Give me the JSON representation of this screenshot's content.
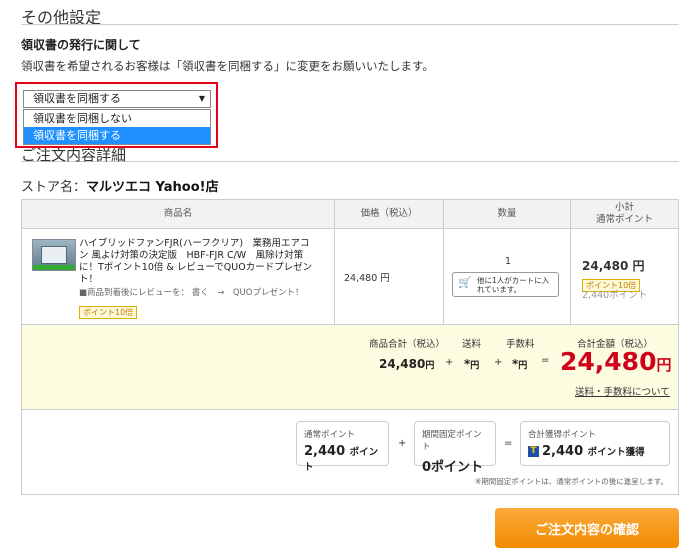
{
  "other_settings": {
    "title": "その他設定",
    "receipt_heading": "領収書の発行に関して",
    "receipt_desc": "領収書を希望されるお客様は「領収書を同梱する」に変更をお願いいたします。",
    "select_value": "領収書を同梱する",
    "options": [
      "領収書を同梱しない",
      "領収書を同梱する"
    ],
    "highlight_color": "#1e90ff",
    "frame_color": "#e4001b"
  },
  "order": {
    "title": "ご注文内容詳細",
    "store_label": "ストア名：",
    "store_name": "マルツエコ Yahoo!店"
  },
  "table": {
    "headers": {
      "product": "商品名",
      "price": "価格（税込）",
      "qty": "数量",
      "subtotal_line1": "小計",
      "subtotal_line2": "通常ポイント"
    },
    "item": {
      "name": "ハイブリッドファンFJR(ハーフクリア)　業務用エアコン 風よけ対策の決定版　HBF-FJR C/W　風除け対策に！Tポイント10倍 & レビューでQUOカードプレゼント！",
      "review_note": "■商品到着後にレビューを： 書く　→　QUOプレゼント！",
      "badge": "ポイント10倍",
      "price": "24,480 円",
      "qty": "1",
      "cart_note": "他に1人がカートに入れています。",
      "subtotal": "24,480 円",
      "subtotal_badge": "ポイント10倍",
      "subtotal_points": "2,440ポイント"
    }
  },
  "totals": {
    "goods_label": "商品合計（税込）",
    "goods_value": "24,480",
    "yen": "円",
    "shipping_label": "送料",
    "shipping_value": "*",
    "fee_label": "手数料",
    "fee_value": "*",
    "grand_label": "合計金額（税込）",
    "grand_value": "24,480",
    "plus": "+",
    "equals": "=",
    "link": "送料・手数料について"
  },
  "points": {
    "normal_label": "通常ポイント",
    "normal_value": "2,440",
    "normal_unit": "ポイント",
    "fixed_label": "期間固定ポイント",
    "fixed_value": "0ポイント",
    "total_label": "合計獲得ポイント",
    "total_value": "2,440",
    "total_unit": "ポイント獲得",
    "plus": "+",
    "equals": "=",
    "t_mark": "T",
    "note": "※期間固定ポイントは、通常ポイントの後に進呈します。"
  },
  "confirm_button": "ご注文内容の確認"
}
